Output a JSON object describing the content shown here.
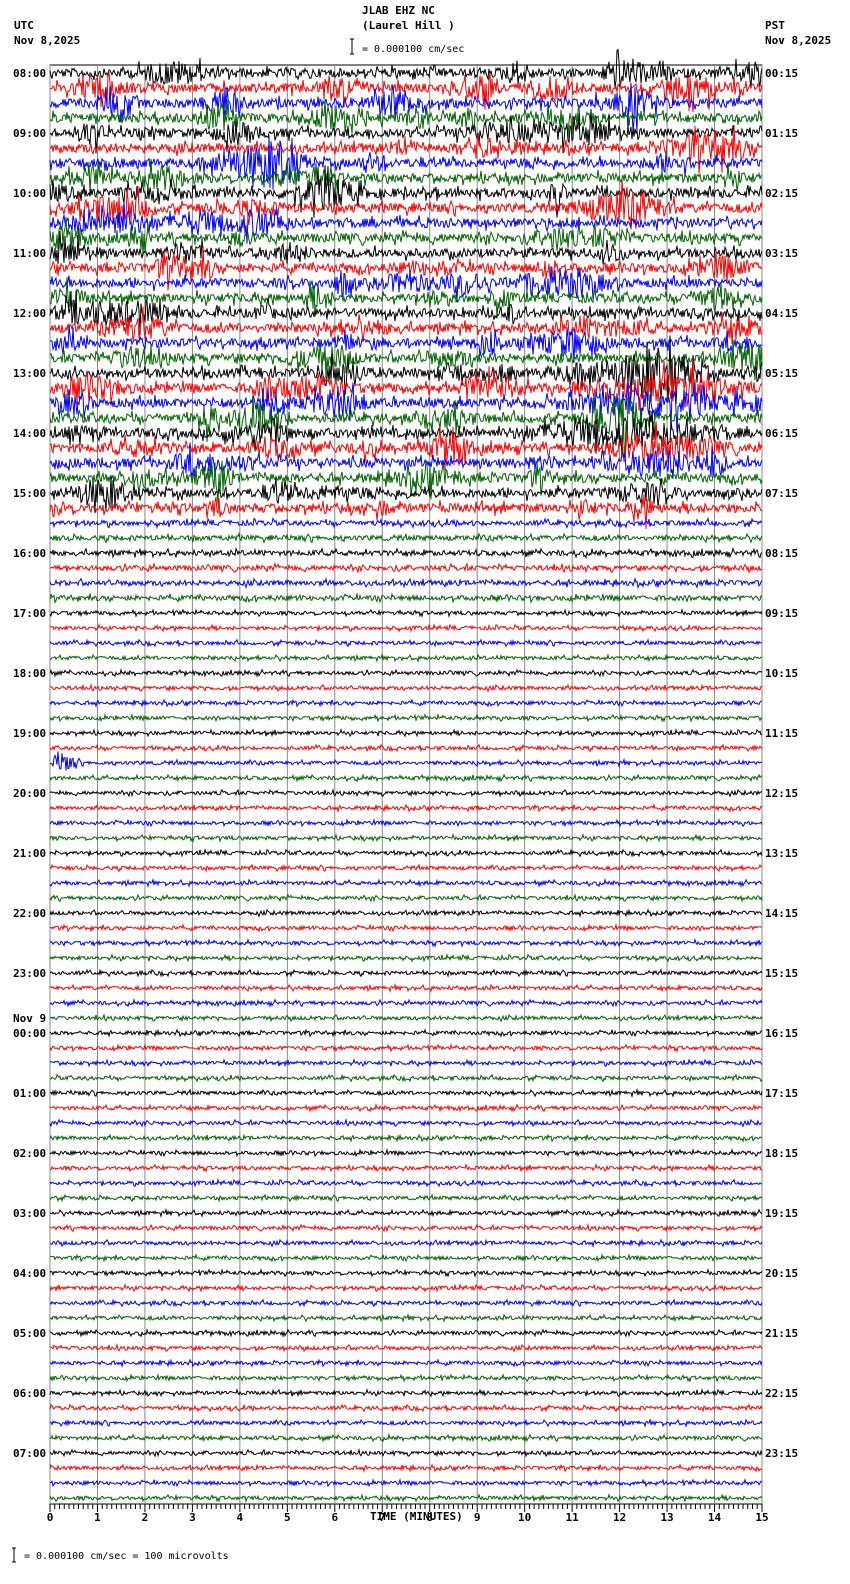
{
  "header": {
    "station": "JLAB EHZ NC",
    "location": "(Laurel Hill )",
    "left_tz": "UTC",
    "left_date": "Nov 8,2025",
    "right_tz": "PST",
    "right_date": "Nov 8,2025",
    "scale": "= 0.000100 cm/sec"
  },
  "footer": {
    "scale_note": "= 0.000100 cm/sec =     100 microvolts"
  },
  "chart_data": {
    "type": "line",
    "title": "JLAB EHZ NC (Laurel Hill )",
    "xlabel": "TIME (MINUTES)",
    "xlim": [
      0,
      15
    ],
    "x_ticks": [
      "0",
      "1",
      "2",
      "3",
      "4",
      "5",
      "6",
      "7",
      "8",
      "9",
      "10",
      "11",
      "12",
      "13",
      "14",
      "15"
    ],
    "trace_colors": [
      "#000000",
      "#ff0000",
      "#0000ff",
      "#006400"
    ],
    "traces_per_hour": 4,
    "left_labels": [
      "08:00",
      "09:00",
      "10:00",
      "11:00",
      "12:00",
      "13:00",
      "14:00",
      "15:00",
      "16:00",
      "17:00",
      "18:00",
      "19:00",
      "20:00",
      "21:00",
      "22:00",
      "23:00",
      "00:00",
      "01:00",
      "02:00",
      "03:00",
      "04:00",
      "05:00",
      "06:00",
      "07:00"
    ],
    "date_change_label": "Nov 9",
    "right_labels": [
      "00:15",
      "01:15",
      "02:15",
      "03:15",
      "04:15",
      "05:15",
      "06:15",
      "07:15",
      "08:15",
      "09:15",
      "10:15",
      "11:15",
      "12:15",
      "13:15",
      "14:15",
      "15:15",
      "16:15",
      "17:15",
      "18:15",
      "19:15",
      "20:15",
      "21:15",
      "22:15",
      "23:15"
    ],
    "grid": "vertical every minute"
  }
}
